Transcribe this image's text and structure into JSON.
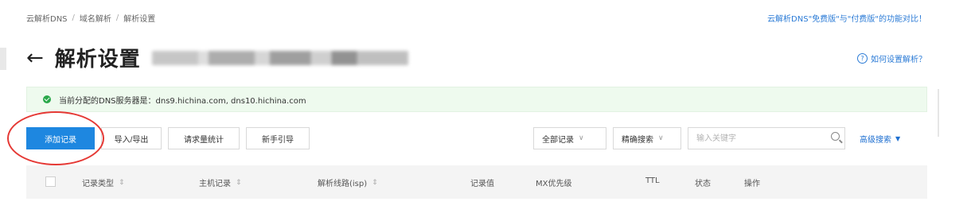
{
  "breadcrumb": [
    "云解析DNS",
    "域名解析",
    "解析设置"
  ],
  "breadcrumb_sep": "/",
  "top_link": "云解析DNS\"免费版\"与\"付费版\"的功能对比！",
  "page": {
    "back_icon": "←",
    "title": "解析设置"
  },
  "help": {
    "icon": "?",
    "label": "如何设置解析？"
  },
  "dns_info": {
    "text": "当前分配的DNS服务器是：dns9.hichina.com, dns10.hichina.com"
  },
  "toolbar": {
    "add_record": "添加记录",
    "import_export": "导入/导出",
    "request_stats": "请求量统计",
    "guide": "新手引导"
  },
  "filters": {
    "all_records": "全部记录",
    "precise_search": "精确搜索",
    "search_placeholder": "输入关键字",
    "advanced_search": "高级搜索",
    "chevron": "∨",
    "advanced_triangle": "▼"
  },
  "table": {
    "sort_symbol": "⇕",
    "columns": [
      "记录类型",
      "主机记录",
      "解析线路(isp)",
      "记录值",
      "MX优先级",
      "TTL",
      "状态",
      "操作"
    ]
  },
  "colors": {
    "primary": "#1e87e0",
    "link": "#2b7bd6",
    "success": "#2aa84a",
    "annotation": "#e53935"
  },
  "icons": [
    "back-arrow-icon",
    "help-icon",
    "check-circle-icon",
    "search-icon",
    "dropdown-chevron-icon",
    "sort-icon"
  ]
}
